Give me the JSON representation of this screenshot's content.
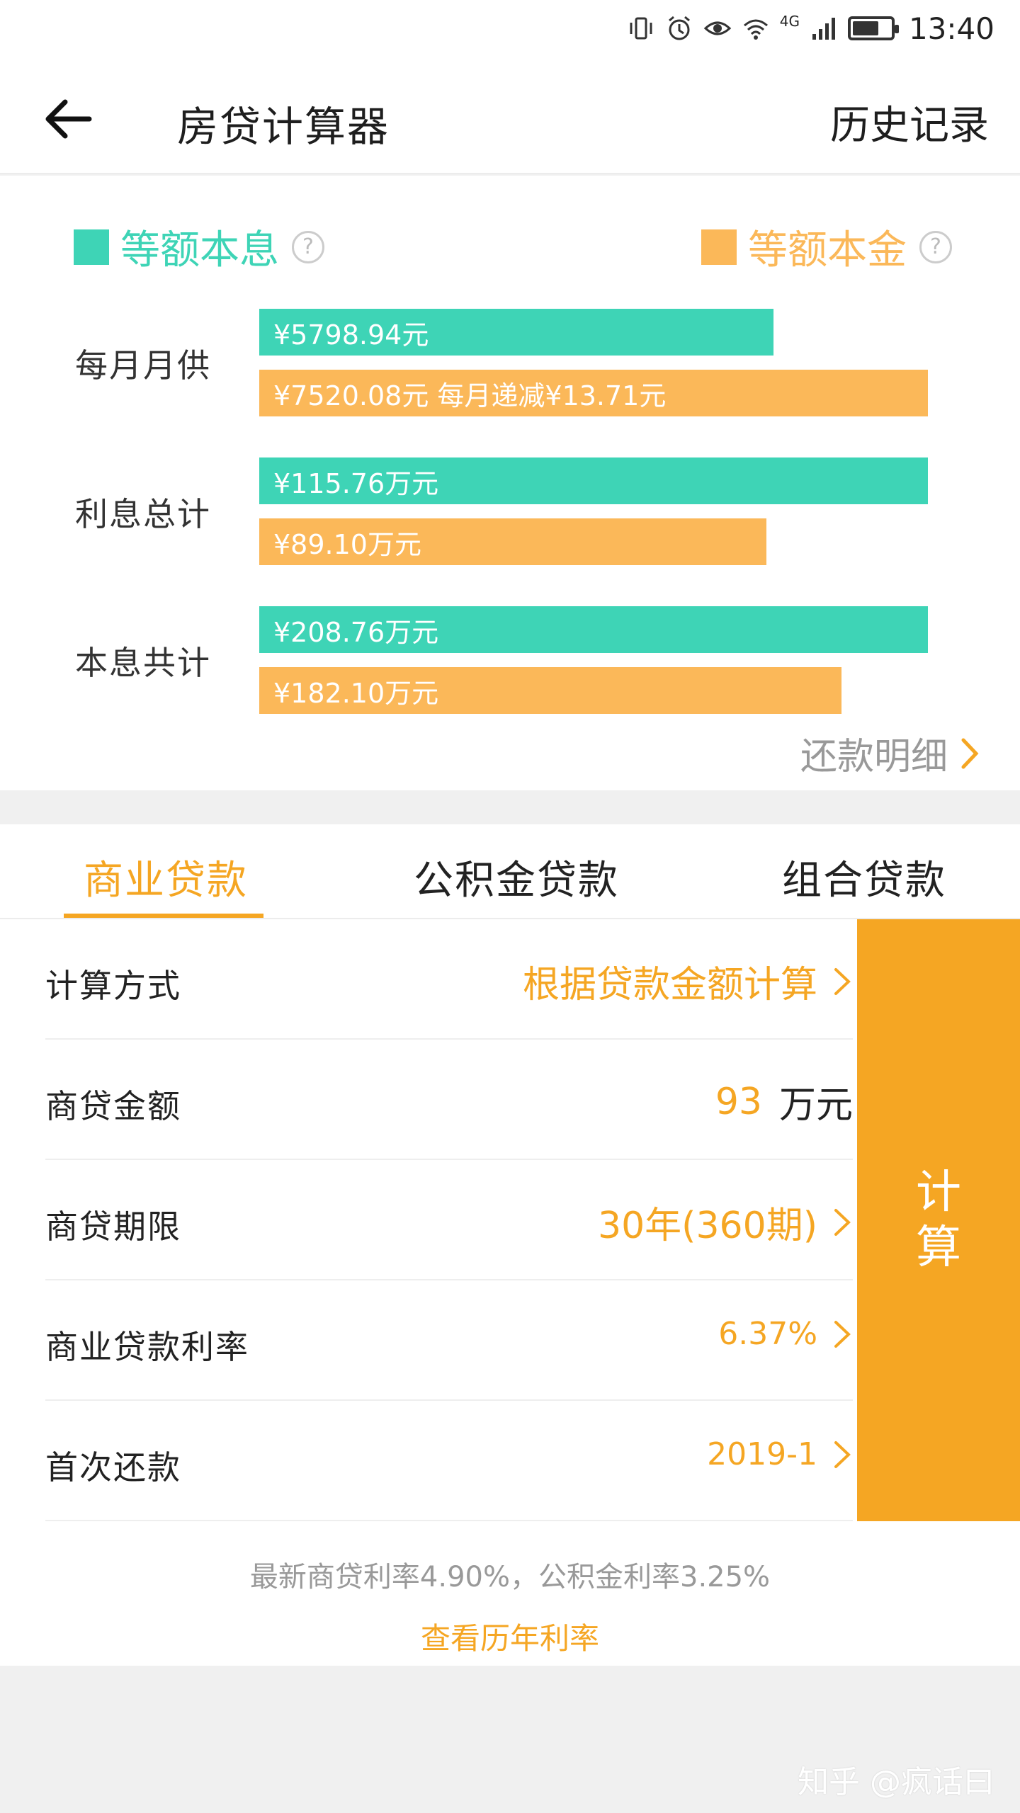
{
  "status_bar": {
    "network": "4G",
    "time": "13:40",
    "battery_level": 0.7
  },
  "header": {
    "title": "房贷计算器",
    "history_label": "历史记录"
  },
  "comparison": {
    "legend": {
      "equal_installment": "等额本息",
      "equal_principal": "等额本金",
      "help_glyph": "?"
    },
    "colors": {
      "equal_installment": "#3ed4b6",
      "equal_principal": "#fbb859"
    },
    "rows": [
      {
        "label": "每月月供",
        "installment": "¥5798.94元",
        "principal": "¥7520.08元  每月递减¥13.71元"
      },
      {
        "label": "利息总计",
        "installment": "¥115.76万元",
        "principal": "¥89.10万元"
      },
      {
        "label": "本息共计",
        "installment": "¥208.76万元",
        "principal": "¥182.10万元"
      }
    ],
    "detail_link": "还款明细"
  },
  "loan_form": {
    "tabs": [
      "商业贷款",
      "公积金贷款",
      "组合贷款"
    ],
    "active_tab": 0,
    "rows": {
      "method": {
        "label": "计算方式",
        "value": "根据贷款金额计算"
      },
      "amount": {
        "label": "商贷金额",
        "value": "93",
        "unit": "万元"
      },
      "term": {
        "label": "商贷期限",
        "value": "30年(360期)"
      },
      "rate": {
        "label": "商业贷款利率",
        "value": "6.37%"
      },
      "first_payment": {
        "label": "首次还款",
        "value": "2019-1"
      }
    },
    "calculate_button": [
      "计",
      "算"
    ],
    "rate_note": "最新商贷利率4.90%，公积金利率3.25%",
    "rate_history_link": "查看历年利率",
    "accent_color": "#f5a623"
  },
  "watermark": "知乎 @疯话曰"
}
